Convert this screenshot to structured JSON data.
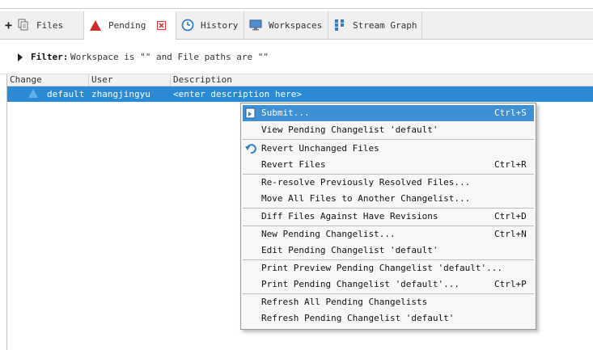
{
  "toolbar": {
    "new_label": "+"
  },
  "tabs": [
    {
      "label": "Files",
      "icon": "files-icon"
    },
    {
      "label": "Pending",
      "icon": "pending-triangle-icon",
      "active": true
    },
    {
      "label": "History",
      "icon": "clock-icon"
    },
    {
      "label": "Workspaces",
      "icon": "monitor-icon"
    },
    {
      "label": "Stream Graph",
      "icon": "stream-graph-icon"
    }
  ],
  "filter": {
    "label": "Filter:",
    "text": "Workspace is \"\" and File paths are \"\""
  },
  "columns": [
    "Change",
    "User",
    "Description"
  ],
  "rows": [
    {
      "change": "default",
      "user": "zhangjingyu",
      "description": "<enter description here>"
    }
  ],
  "context_menu": {
    "items": [
      {
        "label": "Submit...",
        "shortcut": "Ctrl+S",
        "icon": "submit-icon",
        "highlighted": true
      },
      {
        "label": "View Pending Changelist 'default'",
        "shortcut": ""
      },
      {
        "label": "Revert Unchanged Files",
        "shortcut": "",
        "icon": "revert-icon"
      },
      {
        "label": "Revert Files",
        "shortcut": "Ctrl+R"
      },
      {
        "label": "Re-resolve Previously Resolved Files...",
        "shortcut": ""
      },
      {
        "label": "Move All Files to Another Changelist...",
        "shortcut": ""
      },
      {
        "label": "Diff Files Against Have Revisions",
        "shortcut": "Ctrl+D"
      },
      {
        "label": "New Pending Changelist...",
        "shortcut": "Ctrl+N"
      },
      {
        "label": "Edit Pending Changelist 'default'",
        "shortcut": ""
      },
      {
        "label": "Print Preview Pending Changelist 'default'...",
        "shortcut": ""
      },
      {
        "label": "Print Pending Changelist 'default'...",
        "shortcut": "Ctrl+P"
      },
      {
        "label": "Refresh All Pending Changelists",
        "shortcut": ""
      },
      {
        "label": "Refresh Pending Changelist 'default'",
        "shortcut": ""
      }
    ]
  },
  "colors": {
    "selection": "#2a8ad4",
    "menu_highlight": "#3e8fd6",
    "pending_red": "#d12a2a",
    "close_red": "#e23a3a",
    "accent_blue": "#2d7fd1"
  }
}
